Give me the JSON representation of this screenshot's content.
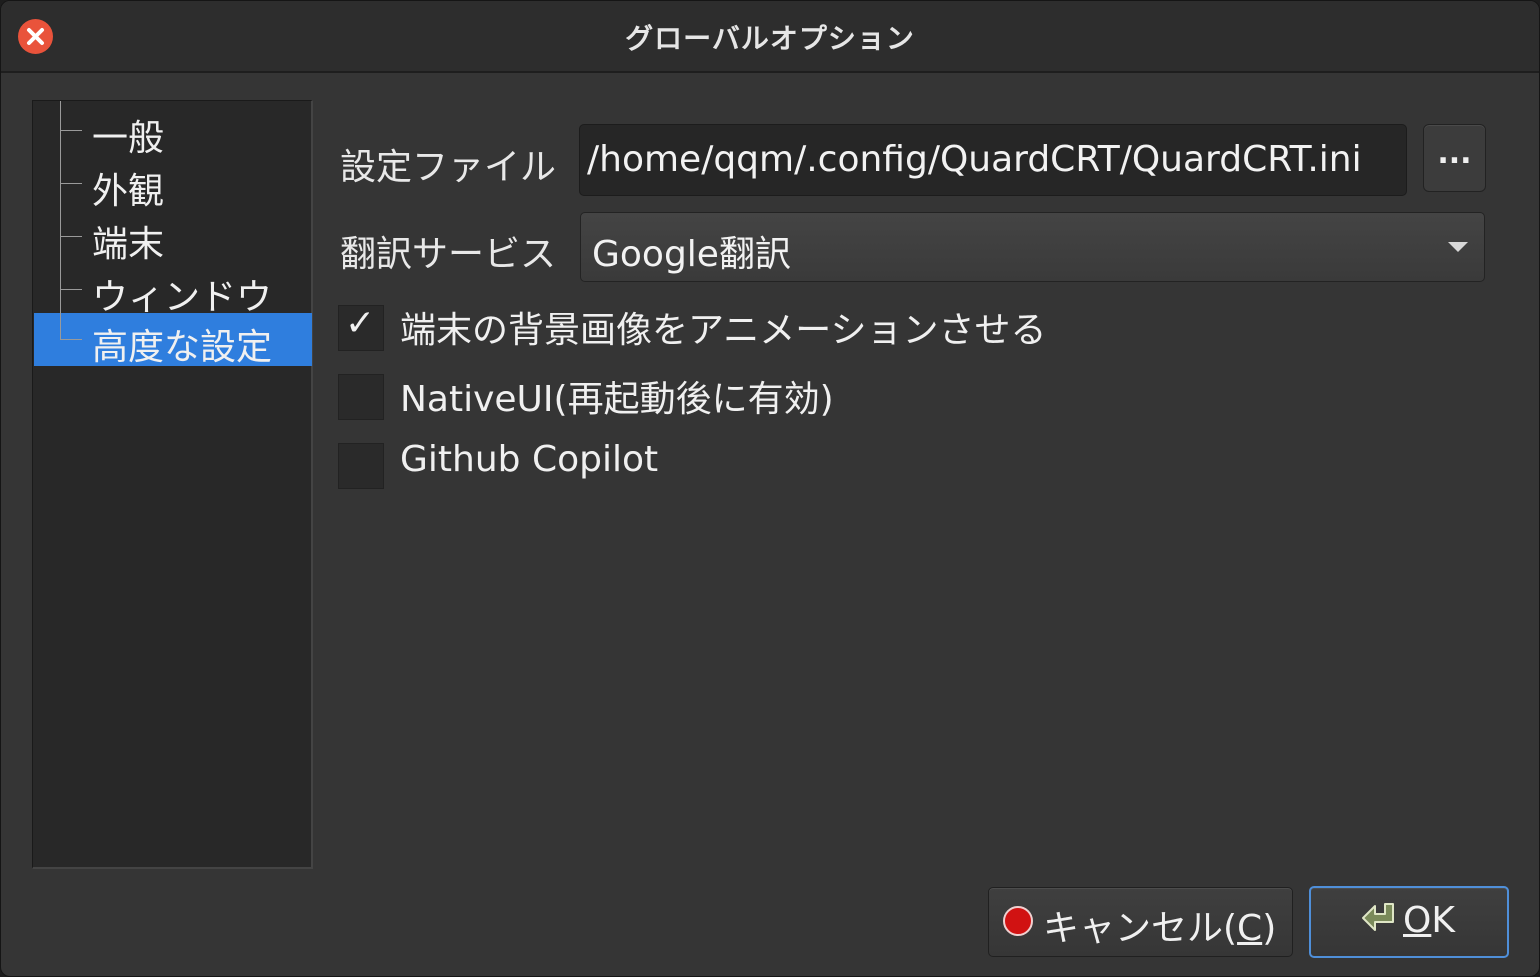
{
  "window": {
    "title": "グローバルオプション"
  },
  "sidebar": {
    "items": [
      {
        "label": "一般",
        "selected": false
      },
      {
        "label": "外観",
        "selected": false
      },
      {
        "label": "端末",
        "selected": false
      },
      {
        "label": "ウィンドウ",
        "selected": false
      },
      {
        "label": "高度な設定",
        "selected": true
      }
    ]
  },
  "settings_file": {
    "label": "設定ファイル",
    "value": "/home/qqm/.config/QuardCRT/QuardCRT.ini",
    "browse_label": "..."
  },
  "translation_service": {
    "label": "翻訳サービス",
    "selected": "Google翻訳"
  },
  "checkboxes": [
    {
      "label": "端末の背景画像をアニメーションさせる",
      "checked": true,
      "mark": "✓"
    },
    {
      "label": "NativeUI(再起動後に有効)",
      "checked": false,
      "mark": ""
    },
    {
      "label": "Github Copilot",
      "checked": false,
      "mark": ""
    }
  ],
  "buttons": {
    "cancel_label": "キャンセル(",
    "cancel_mnemonic": "C",
    "cancel_suffix": ")",
    "ok_mnemonic": "O",
    "ok_rest": "K"
  },
  "colors": {
    "selection": "#2f7ede",
    "close": "#e9533b",
    "default_button_border": "#4f8fd9"
  }
}
